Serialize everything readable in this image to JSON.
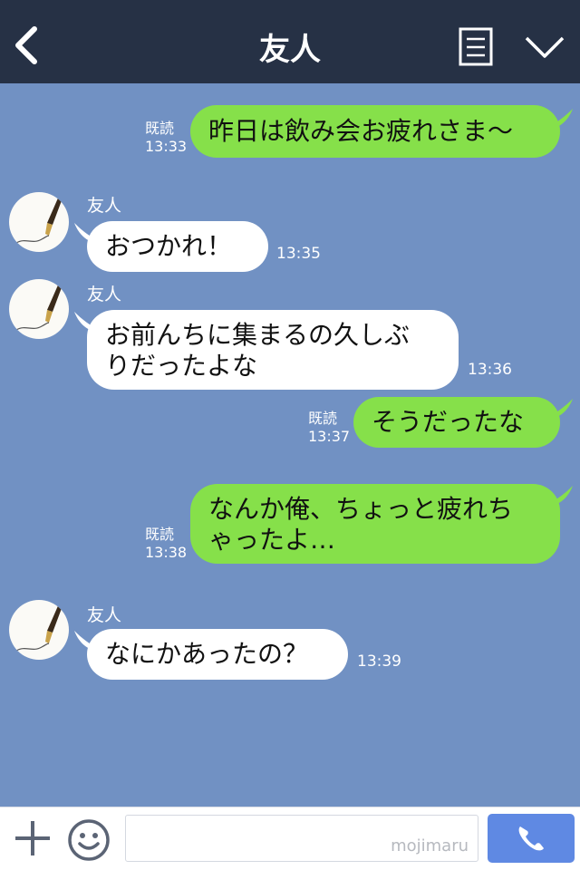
{
  "header": {
    "title": "友人"
  },
  "messages": [
    {
      "side": "me",
      "text": "昨日は飲み会お疲れさま〜",
      "read": "既読",
      "time": "13:33"
    },
    {
      "side": "them",
      "sender": "友人",
      "text": "おつかれ！",
      "time": "13:35"
    },
    {
      "side": "them",
      "sender": "友人",
      "text_line1": "お前んちに集まるの久しぶ",
      "text_line2": "りだったよな",
      "time": "13:36"
    },
    {
      "side": "me",
      "text": "そうだったな",
      "read": "既読",
      "time": "13:37"
    },
    {
      "side": "me",
      "text_line1": "なんか俺、ちょっと疲れち",
      "text_line2": "ゃったよ…",
      "read": "既読",
      "time": "13:38"
    },
    {
      "side": "them",
      "sender": "友人",
      "text": "なにかあったの？",
      "time": "13:39"
    }
  ],
  "footer": {
    "watermark": "mojimaru"
  },
  "icons": {
    "back": "chevron-left-icon",
    "menu": "list-icon",
    "collapse": "chevron-down-icon",
    "plus": "plus-icon",
    "emoji": "smiley-icon",
    "call": "phone-icon",
    "avatar": "fountain-pen-icon"
  },
  "colors": {
    "header_bg": "#263145",
    "chat_bg": "#7191c3",
    "my_bubble": "#86e04a",
    "their_bubble": "#ffffff",
    "call_button": "#5f89e3"
  }
}
